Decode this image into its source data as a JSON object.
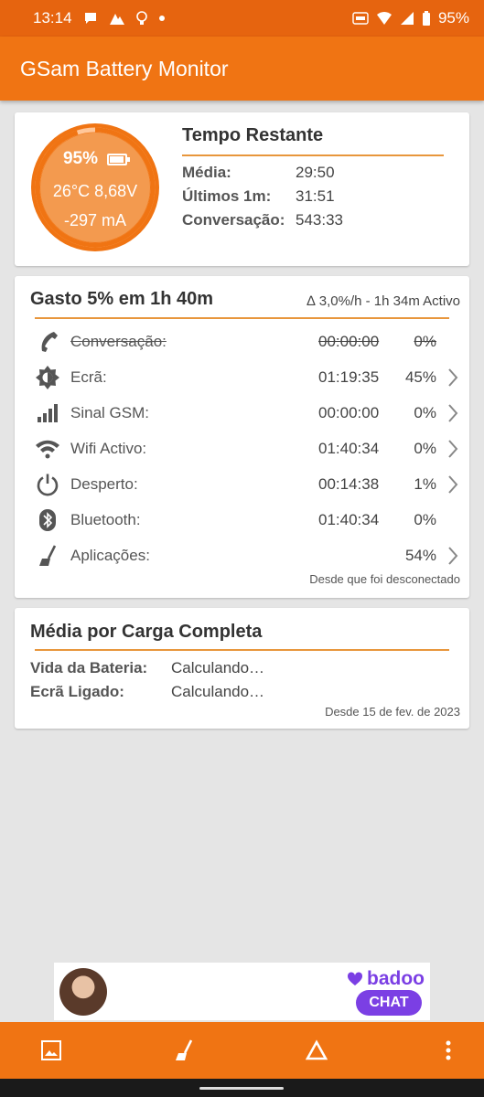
{
  "status_bar": {
    "time": "13:14",
    "battery": "95%",
    "icons_left": [
      "chat-bubble-icon",
      "mountain-app-icon",
      "lightbulb-icon",
      "dot-icon"
    ],
    "icons_right": [
      "auto-hd-icon",
      "wifi-icon",
      "cell-signal-icon",
      "battery-icon"
    ]
  },
  "app_bar": {
    "title": "GSam Battery Monitor"
  },
  "gauge": {
    "percent": "95%",
    "temp_voltage": "26°C  8,68V",
    "current": "-297 mA",
    "level": 0.95,
    "color": "#f07413"
  },
  "tempo_restante": {
    "title": "Tempo Restante",
    "rows": [
      {
        "label": "Média:",
        "value": "29:50"
      },
      {
        "label": "Últimos 1m:",
        "value": "31:51"
      },
      {
        "label": "Conversação:",
        "value": "543:33"
      }
    ]
  },
  "gasto": {
    "title": "Gasto 5% em 1h 40m",
    "subtitle": "∆ 3,0%/h - 1h 34m Activo",
    "rows": [
      {
        "icon": "phone-icon",
        "name": "Conversação:",
        "time": "00:00:00",
        "percent": "0%",
        "struck": true,
        "chevron": false
      },
      {
        "icon": "brightness-icon",
        "name": "Ecrã:",
        "time": "01:19:35",
        "percent": "45%",
        "struck": false,
        "chevron": true
      },
      {
        "icon": "signal-bars-icon",
        "name": "Sinal GSM:",
        "time": "00:00:00",
        "percent": "0%",
        "struck": false,
        "chevron": true
      },
      {
        "icon": "wifi-icon",
        "name": "Wifi Activo:",
        "time": "01:40:34",
        "percent": "0%",
        "struck": false,
        "chevron": true
      },
      {
        "icon": "power-icon",
        "name": "Desperto:",
        "time": "00:14:38",
        "percent": "1%",
        "struck": false,
        "chevron": true
      },
      {
        "icon": "bluetooth-icon",
        "name": "Bluetooth:",
        "time": "01:40:34",
        "percent": "0%",
        "struck": false,
        "chevron": false
      },
      {
        "icon": "broom-icon",
        "name": "Aplicações:",
        "time": "",
        "percent": "54%",
        "struck": false,
        "chevron": true
      }
    ],
    "footer": "Desde que foi desconectado"
  },
  "media_carga": {
    "title": "Média por Carga Completa",
    "rows": [
      {
        "label": "Vida da Bateria:",
        "value": "Calculando…"
      },
      {
        "label": "Ecrã Ligado:",
        "value": "Calculando…"
      }
    ],
    "footer": "Desde 15 de fev. de 2023"
  },
  "ad": {
    "brand": "badoo",
    "cta": "CHAT",
    "brand_color": "#7b3fe4"
  },
  "bottom_bar": {
    "buttons": [
      "image-icon",
      "broom-icon",
      "delta-icon",
      "more-vert-icon"
    ]
  }
}
